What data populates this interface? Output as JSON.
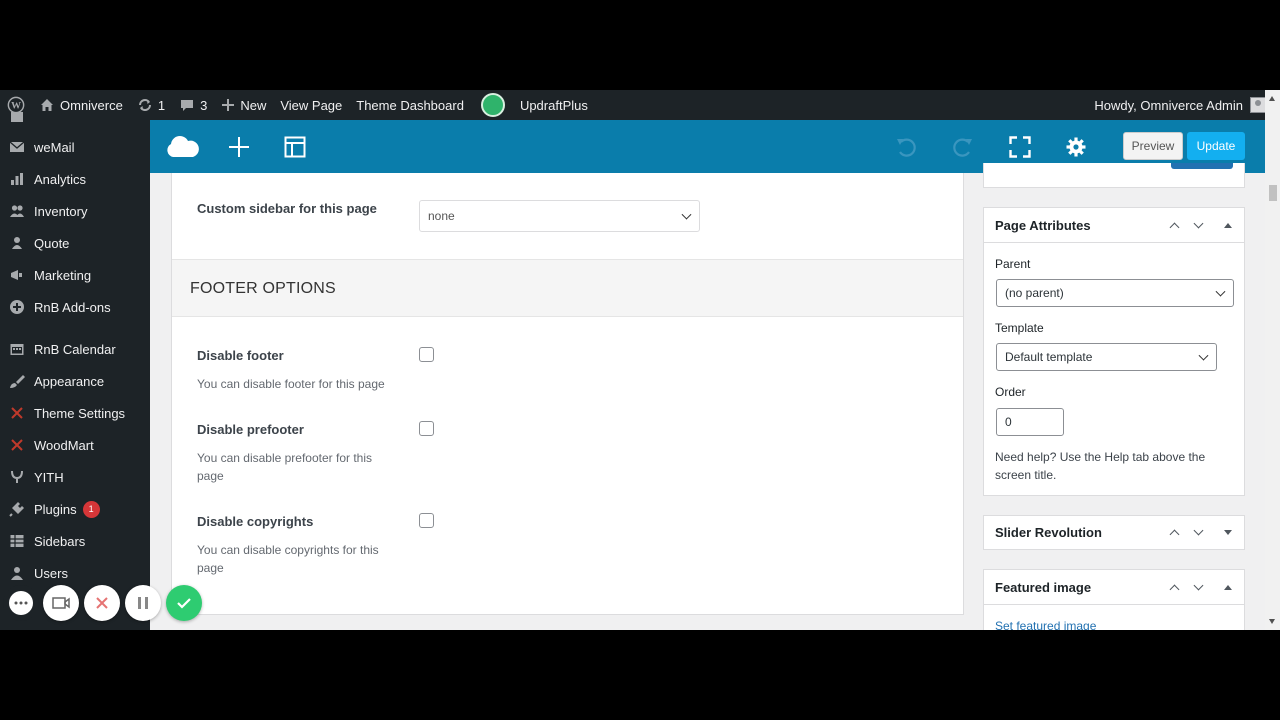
{
  "adminbar": {
    "site_name": "Omniverce",
    "updates_count": "1",
    "comments_count": "3",
    "new_label": "New",
    "view_page_label": "View Page",
    "theme_dashboard_label": "Theme Dashboard",
    "updraft_label": "UpdraftPlus",
    "howdy": "Howdy, Omniverce Admin"
  },
  "sidebar": {
    "items": [
      {
        "label": "weMail",
        "icon": "mail-icon"
      },
      {
        "label": "Analytics",
        "icon": "chart-icon"
      },
      {
        "label": "Inventory",
        "icon": "users-icon"
      },
      {
        "label": "Quote",
        "icon": "quote-icon"
      },
      {
        "label": "Marketing",
        "icon": "megaphone-icon"
      },
      {
        "label": "RnB Add-ons",
        "icon": "plus-circle-icon"
      },
      {
        "label": "RnB Calendar",
        "icon": "calendar-icon"
      },
      {
        "label": "Appearance",
        "icon": "brush-icon"
      },
      {
        "label": "Theme Settings",
        "icon": "theme-icon"
      },
      {
        "label": "WoodMart",
        "icon": "woodmart-icon"
      },
      {
        "label": "YITH",
        "icon": "yith-icon"
      },
      {
        "label": "Plugins",
        "icon": "plugin-icon",
        "badge": "1"
      },
      {
        "label": "Sidebars",
        "icon": "table-icon"
      },
      {
        "label": "Users",
        "icon": "user-icon"
      }
    ]
  },
  "toolbar": {
    "preview_label": "Preview",
    "update_label": "Update",
    "accent": "#0a7dab",
    "update_color": "#13aff0"
  },
  "main": {
    "custom_sidebar_label": "Custom sidebar for this page",
    "custom_sidebar_value": "none",
    "footer_section_title": "FOOTER OPTIONS",
    "fields": [
      {
        "label": "Disable footer",
        "desc": "You can disable footer for this page",
        "checked": false
      },
      {
        "label": "Disable prefooter",
        "desc": "You can disable prefooter for this page",
        "checked": false
      },
      {
        "label": "Disable copyrights",
        "desc": "You can disable copyrights for this page",
        "checked": false
      }
    ]
  },
  "page_attributes": {
    "title": "Page Attributes",
    "parent_label": "Parent",
    "parent_value": "(no parent)",
    "template_label": "Template",
    "template_value": "Default template",
    "order_label": "Order",
    "order_value": "0",
    "help_text": "Need help? Use the Help tab above the screen title."
  },
  "slider_revolution": {
    "title": "Slider Revolution"
  },
  "featured_image": {
    "title": "Featured image",
    "link_label": "Set featured image"
  }
}
